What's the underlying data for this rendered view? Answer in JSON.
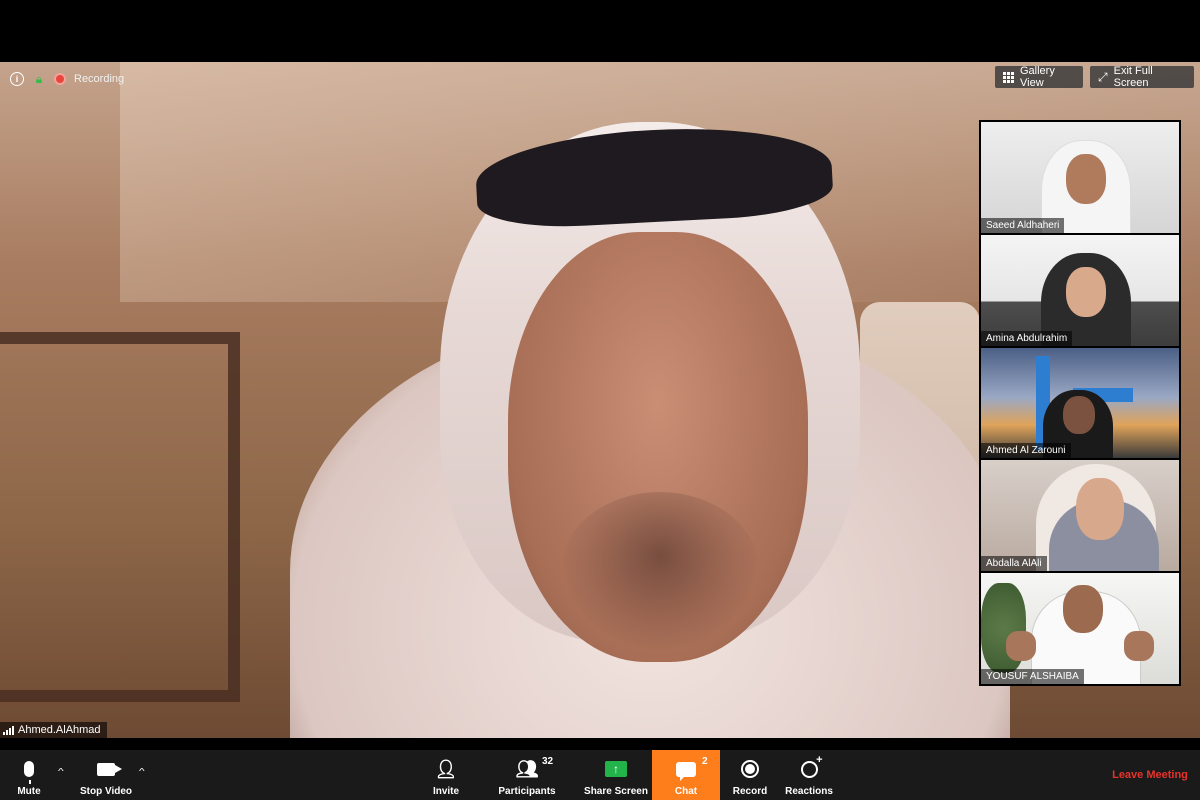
{
  "meeting": {
    "recording_label": "Recording",
    "status_icons": [
      "info-icon",
      "lock-icon",
      "recording-icon"
    ]
  },
  "view_controls": {
    "gallery_view": "Gallery View",
    "exit_full_screen": "Exit Full Screen"
  },
  "active_speaker": {
    "name": "Ahmed.AlAhmad"
  },
  "participants_strip": [
    {
      "name": "Saeed Aldhaheri"
    },
    {
      "name": "Amina Abdulrahim"
    },
    {
      "name": "Ahmed Al Zarouni"
    },
    {
      "name": "Abdalla AlAli"
    },
    {
      "name": "YOUSUF ALSHAIBA"
    }
  ],
  "toolbar": {
    "mute": "Mute",
    "stop_video": "Stop Video",
    "invite": "Invite",
    "participants": "Participants",
    "participants_count": "32",
    "share_screen": "Share Screen",
    "chat": "Chat",
    "chat_unread": "2",
    "record": "Record",
    "reactions": "Reactions",
    "leave_meeting": "Leave Meeting"
  },
  "colors": {
    "chat_active": "#ff7e1c",
    "share_green": "#22b34b",
    "leave_red": "#e8322b",
    "recording_red": "#e8453c",
    "lock_green": "#2fbf46"
  }
}
